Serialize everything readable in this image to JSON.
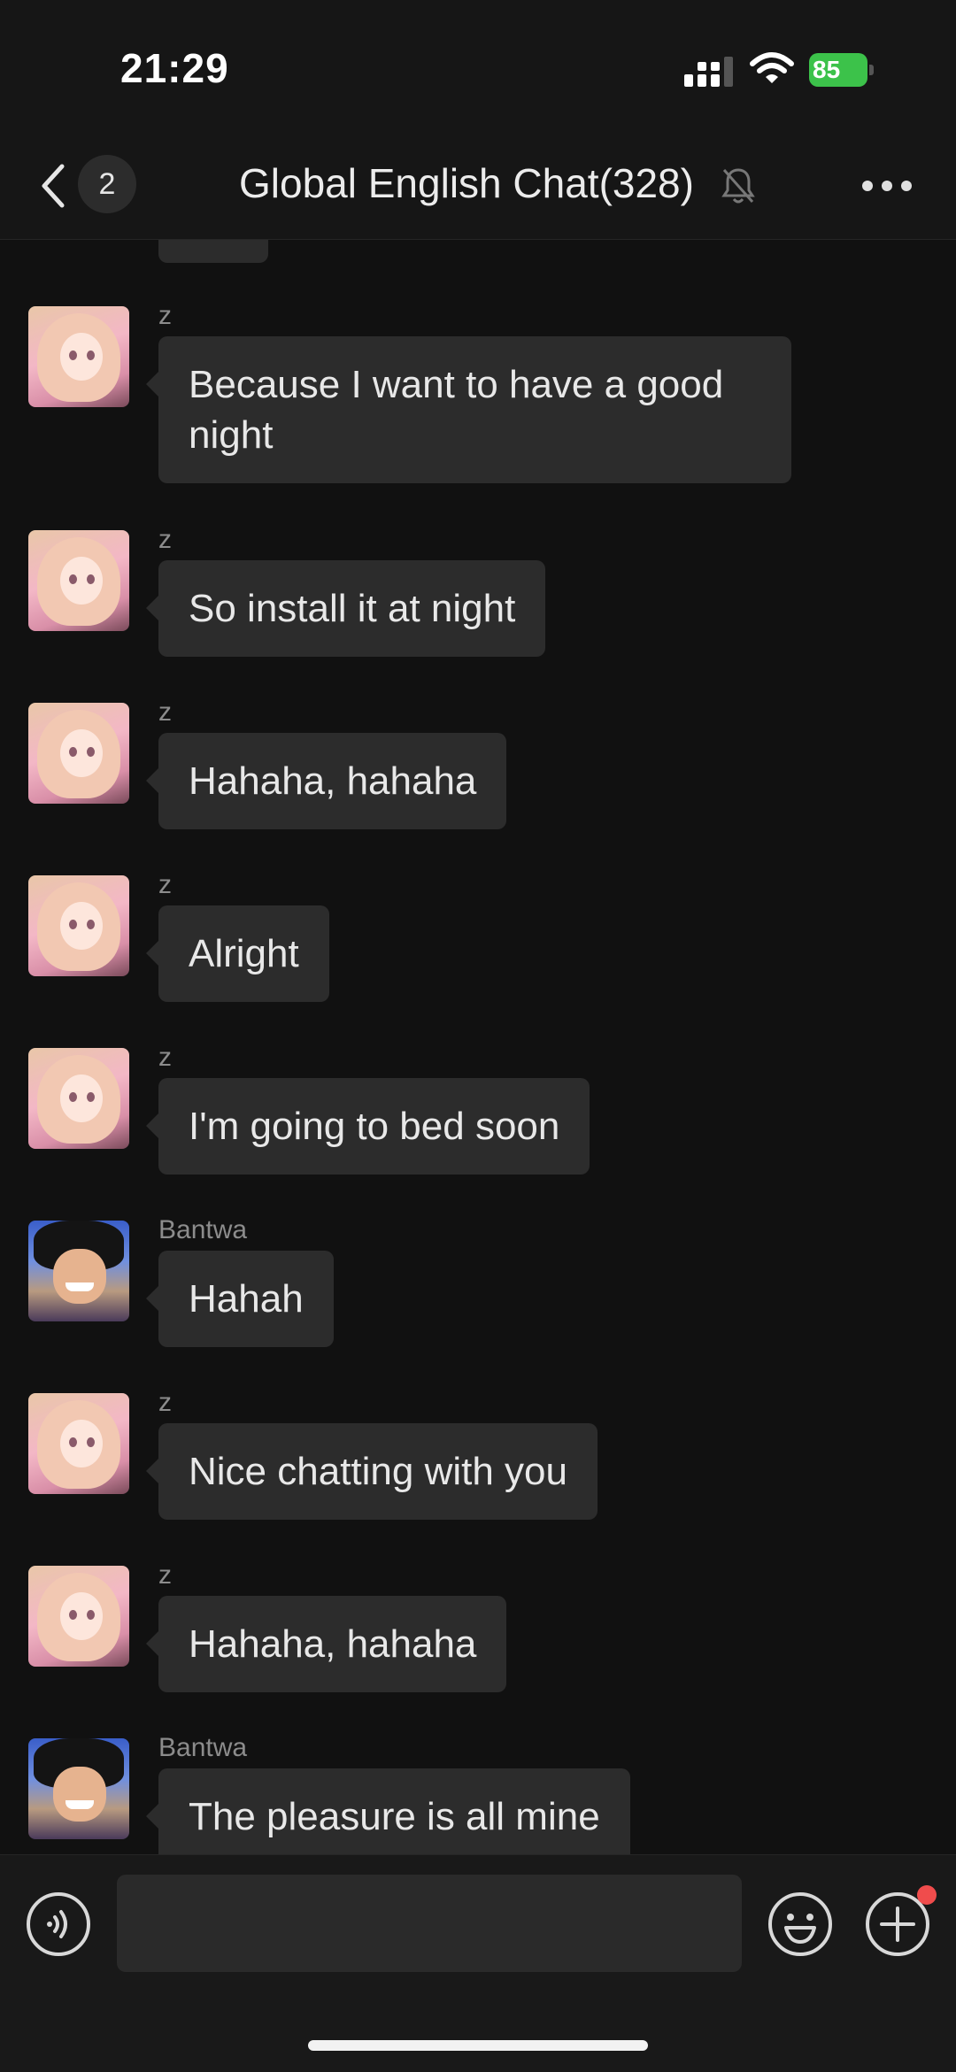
{
  "status_bar": {
    "time": "21:29",
    "battery": "85",
    "battery_color": "#3cc24a"
  },
  "header": {
    "back_icon": "chevron-left-icon",
    "unread_count": "2",
    "title": "Global English Chat(328)",
    "mute_icon": "bell-slash-icon",
    "more_icon": "ellipsis-icon"
  },
  "messages": [
    {
      "sender": "z",
      "avatar": "anime-girl-avatar",
      "text": "Because I want to have a good night"
    },
    {
      "sender": "z",
      "avatar": "anime-girl-avatar",
      "text": "So install it at night"
    },
    {
      "sender": "z",
      "avatar": "anime-girl-avatar",
      "text": "Hahaha, hahaha"
    },
    {
      "sender": "z",
      "avatar": "anime-girl-avatar",
      "text": "Alright"
    },
    {
      "sender": "z",
      "avatar": "anime-girl-avatar",
      "text": "I'm going to bed soon"
    },
    {
      "sender": "Bantwa",
      "avatar": "anime-boy-avatar",
      "text": "Hahah"
    },
    {
      "sender": "z",
      "avatar": "anime-girl-avatar",
      "text": "Nice chatting with you"
    },
    {
      "sender": "z",
      "avatar": "anime-girl-avatar",
      "text": "Hahaha, hahaha"
    },
    {
      "sender": "Bantwa",
      "avatar": "anime-boy-avatar",
      "text": "The pleasure is all mine"
    }
  ],
  "input_bar": {
    "voice_icon": "voice-icon",
    "input_value": "",
    "emoji_icon": "emoji-icon",
    "plus_icon": "plus-circle-icon",
    "notification_dot_color": "#f04c4c"
  },
  "colors": {
    "background": "#111111",
    "bubble": "#2c2c2c",
    "sender_text": "#8c8c8c"
  }
}
